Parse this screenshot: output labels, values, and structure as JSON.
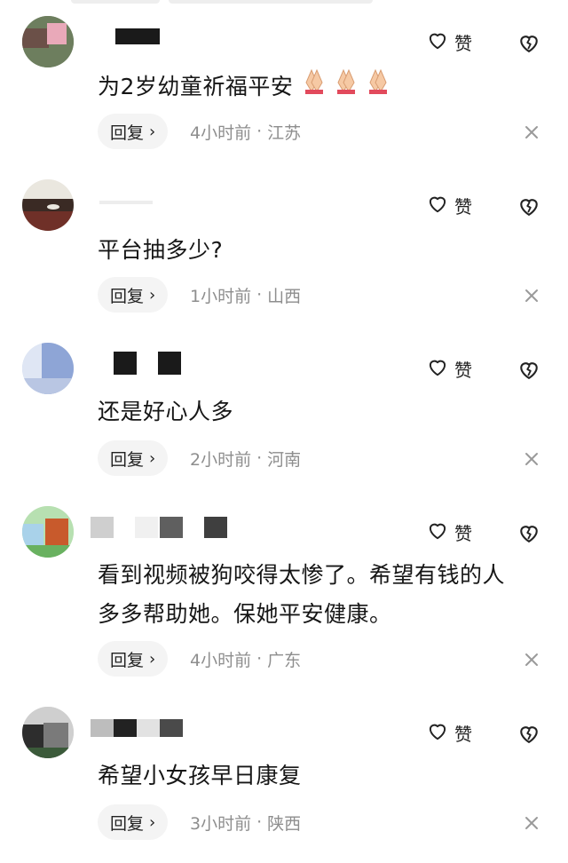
{
  "labels": {
    "like": "赞",
    "reply": "回复",
    "chevron": "›",
    "dot": "·"
  },
  "colors": {
    "meta": "#8e8e8e",
    "reply_bg": "#f4f4f4",
    "text": "#161616"
  },
  "comments": [
    {
      "text": "为2岁幼童祈福平安",
      "emoji": "folded-hands x3",
      "time": "4小时前",
      "location": "江苏"
    },
    {
      "text": "平台抽多少?",
      "time": "1小时前",
      "location": "山西"
    },
    {
      "text": "还是好心人多",
      "time": "2小时前",
      "location": "河南"
    },
    {
      "text_line1": "看到视频被狗咬得太惨了。希望有钱的人",
      "text_line2": "多多帮助她。保她平安健康。",
      "time": "4小时前",
      "location": "广东"
    },
    {
      "text": "希望小女孩早日康复",
      "time": "3小时前",
      "location": "陕西"
    }
  ]
}
